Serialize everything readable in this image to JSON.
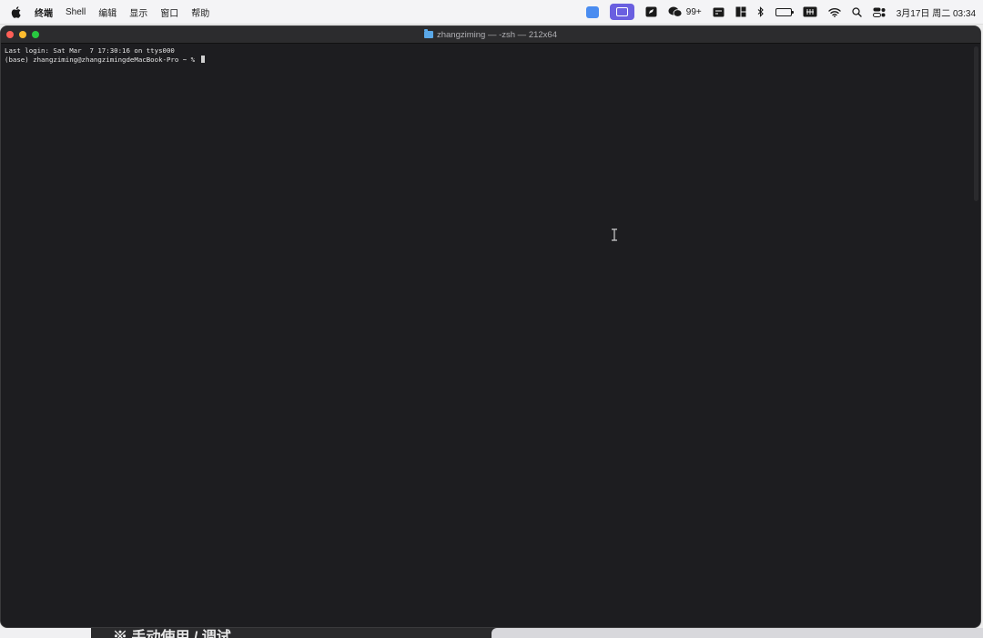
{
  "menubar": {
    "app_name": "终端",
    "items": [
      "Shell",
      "编辑",
      "显示",
      "窗口",
      "帮助"
    ],
    "status_icons": [
      "blue-app-icon",
      "screen-highlight-icon",
      "pen-icon",
      "wechat-icon",
      "display-icon",
      "layout-icon",
      "bluetooth-icon",
      "battery-icon",
      "input-method-icon",
      "wifi-icon",
      "search-icon",
      "control-center-icon"
    ],
    "wechat_badge": "99+",
    "clock": "3月17日 周二  03:34"
  },
  "window": {
    "title": "zhangziming — -zsh — 212x64",
    "lines": [
      "Last login: Sat Mar  7 17:30:16 on ttys000",
      "(base) zhangziming@zhangzimingdeMacBook-Pro ~ % "
    ]
  },
  "background": {
    "behind_text": "※ 手动使用 / 调试"
  }
}
